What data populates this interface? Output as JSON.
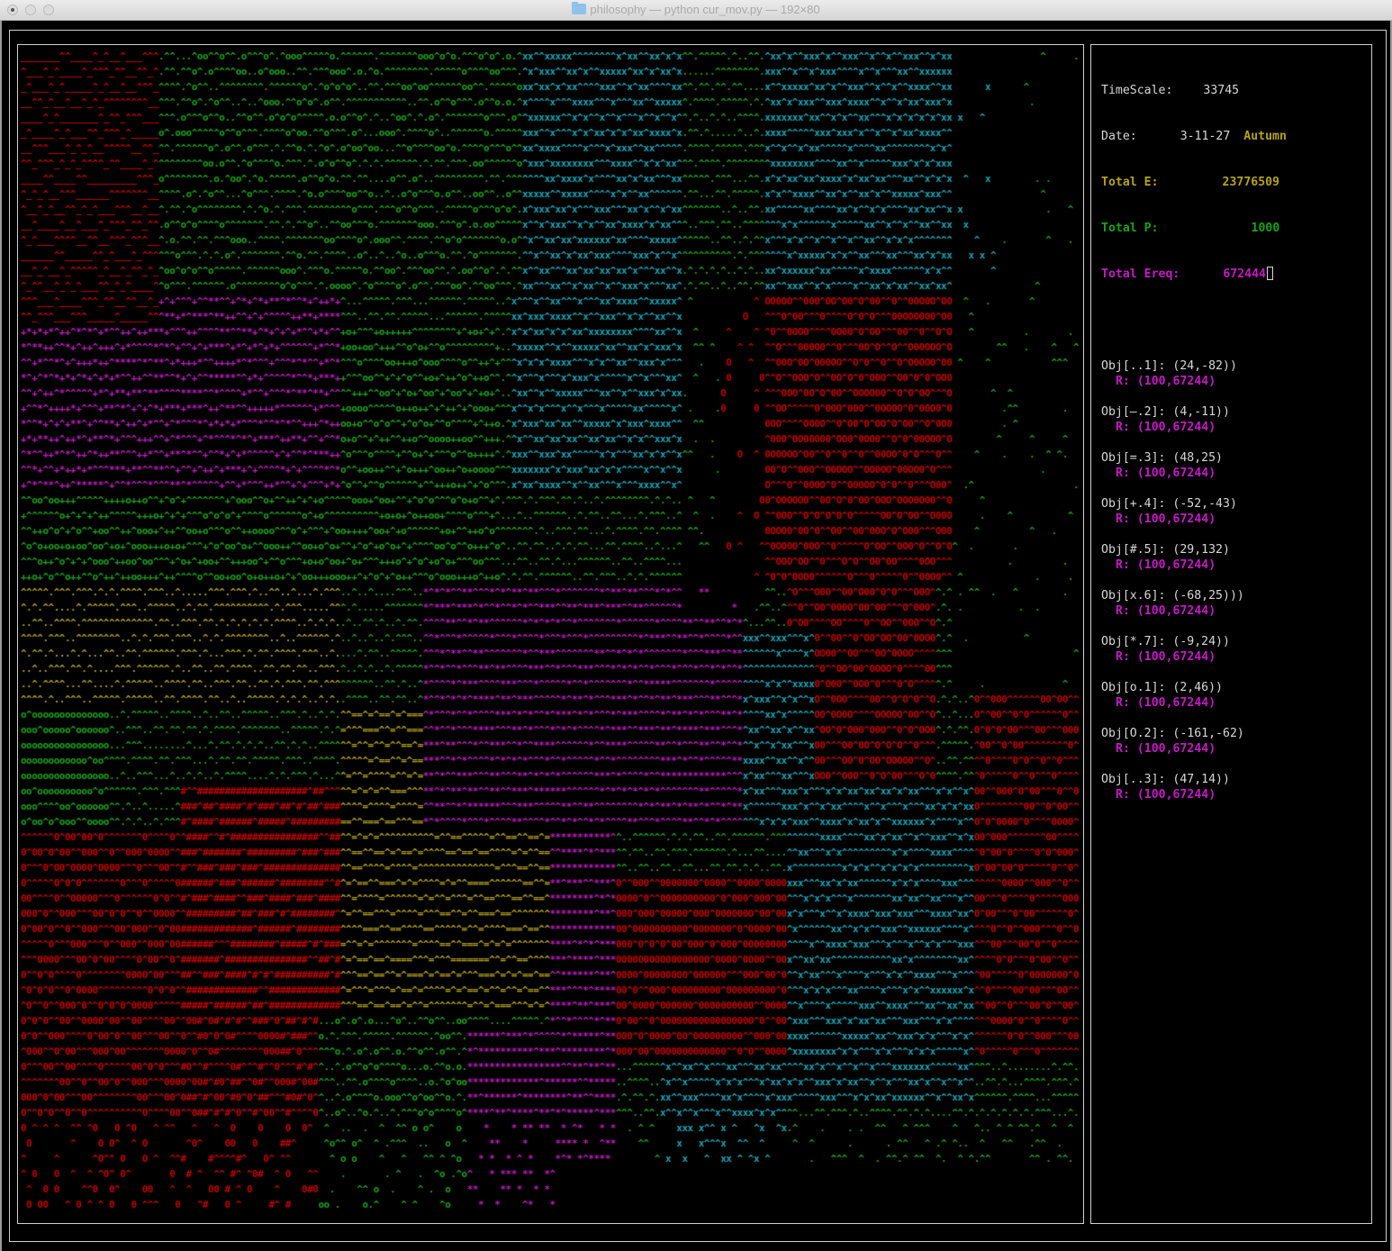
{
  "window": {
    "title": "philosophy — python cur_mov.py — 192×80"
  },
  "stats": {
    "timescale_label": "TimeScale:",
    "timescale_value": "33745",
    "date_label": "Date:",
    "date_value": "3-11-27",
    "season": "Autumn",
    "total_e_label": "Total E:",
    "total_e_value": "23776509",
    "total_p_label": "Total P:",
    "total_p_value": "1000",
    "total_ereq_label": "Total Ereq:",
    "total_ereq_value": "672444"
  },
  "objects": [
    {
      "label": "Obj[..1]:",
      "coords": "(24,-82))",
      "r": "R: (100,67244)"
    },
    {
      "label": "Obj[—.2]:",
      "coords": "(4,-11))",
      "r": "R: (100,67244)"
    },
    {
      "label": "Obj[=.3]:",
      "coords": "(48,25)",
      "r": "R: (100,67244)"
    },
    {
      "label": "Obj[+.4]:",
      "coords": "(-52,-43)",
      "r": "R: (100,67244)"
    },
    {
      "label": "Obj[#.5]:",
      "coords": "(29,132)",
      "r": "R: (100,67244)"
    },
    {
      "label": "Obj[x.6]:",
      "coords": "(-68,25)))",
      "r": "R: (100,67244)"
    },
    {
      "label": "Obj[*.7]:",
      "coords": "(-9,24))",
      "r": "R: (100,67244)"
    },
    {
      "label": "Obj[o.1]:",
      "coords": "(2,46))",
      "r": "R: (100,67244)"
    },
    {
      "label": "Obj[O.2]:",
      "coords": "(-161,-62)",
      "r": "R: (100,67244)"
    },
    {
      "label": "Obj[..3]:",
      "coords": "(47,14))",
      "r": "R: (100,67244)"
    }
  ],
  "colors": {
    "red": "#c40000",
    "green": "#19a319",
    "cyan": "#17a6b8",
    "magenta": "#c618c6",
    "yellow": "#b5a21a",
    "white": "#d7d7d7"
  }
}
